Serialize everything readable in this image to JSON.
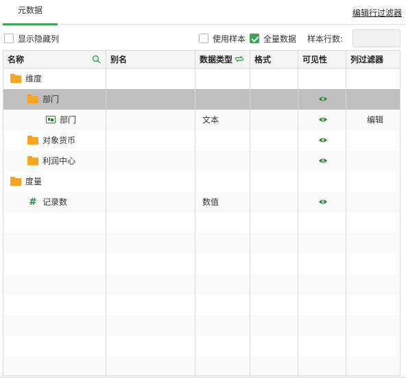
{
  "tabs": {
    "metadata_label": "元数据"
  },
  "edit_filter_label": "编辑行过滤器",
  "toolbar": {
    "show_hidden_label": "显示隐藏列",
    "use_sample_label": "使用样本",
    "full_data_label": "全量数据",
    "sample_rows_label": "样本行数:"
  },
  "columns": {
    "name": "名称",
    "alias": "别名",
    "data_type": "数据类型",
    "format": "格式",
    "visibility": "可见性",
    "column_filter": "列过滤器"
  },
  "rows": [
    {
      "name": "维度",
      "type": "",
      "icon": "folder-icon"
    },
    {
      "name": "部门",
      "type": "",
      "icon": "folder-icon",
      "visible": true,
      "selected": true
    },
    {
      "name": "部门",
      "type": "文本",
      "icon": "text-field-icon",
      "visible": true,
      "filter": "编辑"
    },
    {
      "name": "对象货币",
      "type": "",
      "icon": "folder-icon",
      "visible": true
    },
    {
      "name": "利润中心",
      "type": "",
      "icon": "folder-icon",
      "visible": true
    },
    {
      "name": "度量",
      "type": "",
      "icon": "folder-icon"
    },
    {
      "name": "记录数",
      "type": "数值",
      "icon": "hash-icon",
      "visible": true
    }
  ],
  "colors": {
    "accent": "#3aa757",
    "folder": "#f5a623",
    "eye": "#2e7d32"
  }
}
